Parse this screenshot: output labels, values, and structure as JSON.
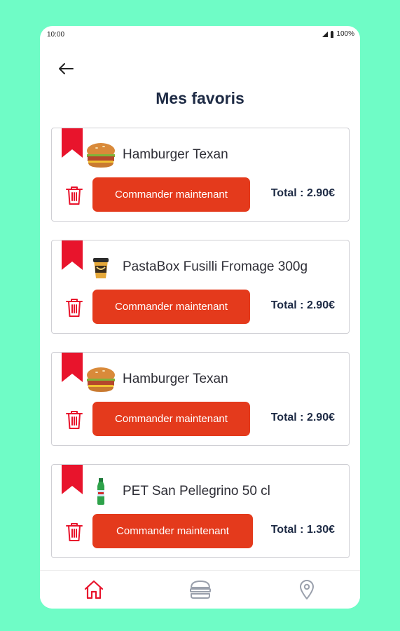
{
  "status_bar": {
    "time": "10:00",
    "battery": "100%"
  },
  "header": {
    "title": "Mes favoris"
  },
  "favorites": [
    {
      "name": "Hamburger Texan",
      "button_label": "Commander maintenant",
      "total": "Total : 2.90€",
      "image": "burger"
    },
    {
      "name": "PastaBox Fusilli Fromage 300g",
      "button_label": "Commander maintenant",
      "total": "Total : 2.90€",
      "image": "pastabox"
    },
    {
      "name": "Hamburger Texan",
      "button_label": "Commander maintenant",
      "total": "Total : 2.90€",
      "image": "burger"
    },
    {
      "name": "PET San Pellegrino 50 cl",
      "button_label": "Commander maintenant",
      "total": "Total : 1.30€",
      "image": "bottle"
    }
  ],
  "bottom_nav": [
    {
      "icon": "home-icon",
      "active": true
    },
    {
      "icon": "burger-icon",
      "active": false
    },
    {
      "icon": "location-pin-icon",
      "active": false
    }
  ],
  "colors": {
    "background": "#6ffcc6",
    "accent": "#e43a1c",
    "bookmark": "#e8142c",
    "title": "#1d2a44",
    "inactive_icon": "#9aa0ac"
  }
}
